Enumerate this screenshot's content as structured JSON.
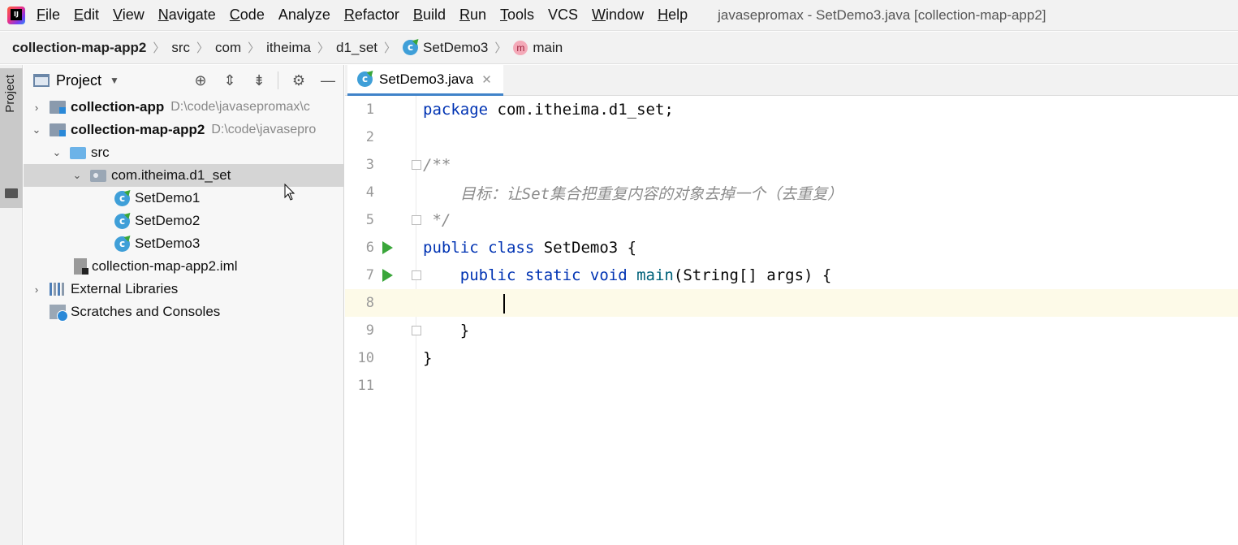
{
  "menu": {
    "items": [
      {
        "mnemonic": "F",
        "rest": "ile"
      },
      {
        "mnemonic": "E",
        "rest": "dit"
      },
      {
        "mnemonic": "V",
        "rest": "iew"
      },
      {
        "mnemonic": "N",
        "rest": "avigate"
      },
      {
        "mnemonic": "C",
        "rest": "ode"
      },
      {
        "mnemonic": "",
        "rest": "Analyze"
      },
      {
        "mnemonic": "R",
        "rest": "efactor"
      },
      {
        "mnemonic": "B",
        "rest": "uild"
      },
      {
        "mnemonic": "R",
        "rest": "un"
      },
      {
        "mnemonic": "T",
        "rest": "ools"
      },
      {
        "mnemonic": "",
        "rest": "VCS"
      },
      {
        "mnemonic": "W",
        "rest": "indow"
      },
      {
        "mnemonic": "H",
        "rest": "elp"
      }
    ],
    "window_title": "javasepromax - SetDemo3.java [collection-map-app2]"
  },
  "breadcrumb": {
    "items": [
      "collection-map-app2",
      "src",
      "com",
      "itheima",
      "d1_set",
      "SetDemo3",
      "main"
    ]
  },
  "toolstrip": {
    "label": "Project"
  },
  "project": {
    "title": "Project",
    "tree": [
      {
        "label": "collection-app",
        "path": "D:\\code\\javasepromax\\c"
      },
      {
        "label": "collection-map-app2",
        "path": "D:\\code\\javasepro"
      },
      {
        "label": "src"
      },
      {
        "label": "com.itheima.d1_set"
      },
      {
        "label": "SetDemo1"
      },
      {
        "label": "SetDemo2"
      },
      {
        "label": "SetDemo3"
      },
      {
        "label": "collection-map-app2.iml"
      },
      {
        "label": "External Libraries"
      },
      {
        "label": "Scratches and Consoles"
      }
    ]
  },
  "editor": {
    "tab_label": "SetDemo3.java",
    "line_numbers": [
      "1",
      "2",
      "3",
      "4",
      "5",
      "6",
      "7",
      "8",
      "9",
      "10",
      "11"
    ],
    "code": {
      "l1_kw": "package",
      "l1_rest": " com.itheima.d1_set;",
      "l3": "/**",
      "l4": "    目标：让Set集合把重复内容的对象去掉一个（去重复）",
      "l5": " */",
      "l6_kw": "public class",
      "l6_rest": " SetDemo3 {",
      "l7_kw": "    public static void",
      "l7_fn": " main",
      "l7_rest": "(String[] args) {",
      "l9": "    }",
      "l10": "}"
    }
  },
  "colors": {
    "keyword": "#0033b3",
    "comment": "#8c8c8c",
    "method": "#00627a",
    "selection": "#d5d5d5",
    "current_line": "#fdfae8",
    "run_icon": "#3aa63a"
  }
}
